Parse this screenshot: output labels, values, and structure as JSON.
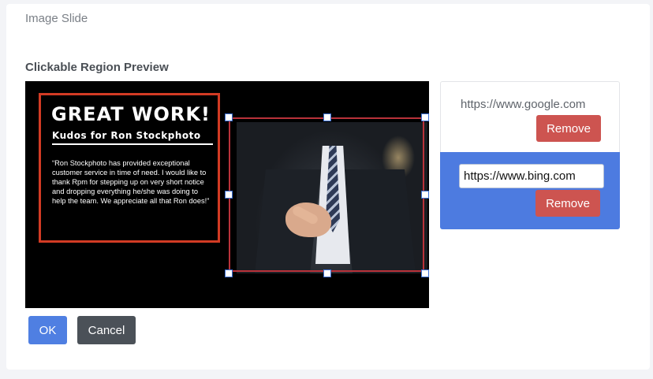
{
  "header": {
    "title": "Image Slide"
  },
  "section": {
    "title": "Clickable Region Preview"
  },
  "slide": {
    "headline": "GREAT WORK!",
    "subheadline": "Kudos for Ron Stockphoto",
    "body": "“Ron Stockphoto has provided exceptional customer service in time of need. I would like to thank Rpm for stepping up on very short notice and dropping everything he/she was doing to help the team. We appreciate all that Ron does!”"
  },
  "links": {
    "items": [
      {
        "url": "https://www.google.com",
        "remove_label": "Remove"
      },
      {
        "url": "https://www.bing.com",
        "remove_label": "Remove"
      }
    ]
  },
  "footer": {
    "ok_label": "OK",
    "cancel_label": "Cancel"
  },
  "colors": {
    "accent": "#4f7fe2",
    "selected_item": "#4d7be0",
    "danger": "#cd5450",
    "region_border": "#b9323a",
    "text_box_border": "#d23b24"
  }
}
